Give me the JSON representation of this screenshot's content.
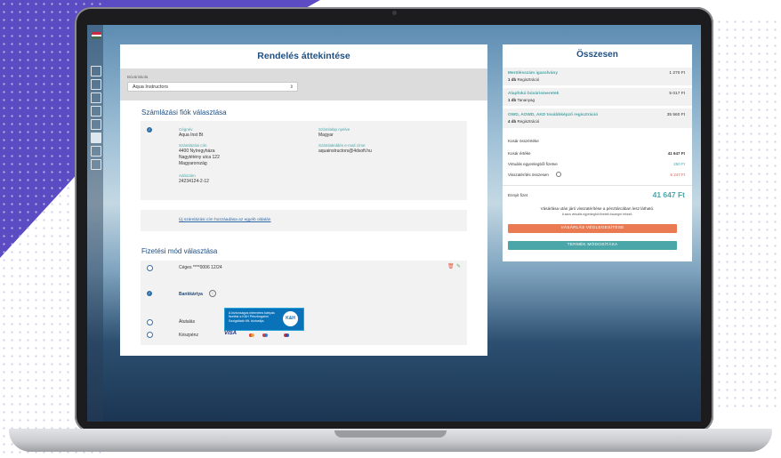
{
  "app": {
    "flag_colors": [
      "#cd2a3e",
      "#ffffff",
      "#436f4d"
    ]
  },
  "order": {
    "title": "Rendelés áttekintése",
    "diving_center_label": "Búváriskola",
    "diving_center_value": "Aqua Instructors",
    "billing_section_title": "Számlázási fiók választása",
    "billing": {
      "company_label": "Cégnév",
      "company_value": "Aqua Inst Bt",
      "language_label": "Számlalap nyelve",
      "language_value": "Magyar",
      "address_label": "Számlázási cím",
      "address_lines": [
        "4400 Nyíregyháza",
        "Nagytétény utca 122",
        "Magyarország"
      ],
      "email_label": "Számlaküldés e-mail címe",
      "email_value": "aquainstructors@4dsoft.hu",
      "tax_label": "Adószám",
      "tax_value": "24234124-2-12"
    },
    "add_billing_link": "Új számlázási cím hozzáadása az egyéb oldalán",
    "payment_section_title": "Fizetési mód választása",
    "payment": {
      "card_saved": "Céges ****0006 12/24",
      "bank_card": "Bankkártya",
      "bank_info": "A biztonságos internetes kártyás fizetést a K&H Pénzforgalmi Szolgáltató Kft. biztosítja.",
      "bank_logo": "K&H",
      "visa": "VISA",
      "transfer": "Átutalás",
      "cash": "Készpénz"
    }
  },
  "summary": {
    "title": "Összesen",
    "items": [
      {
        "name": "Merülésszám igazolvány",
        "qty": "1 db",
        "unit": "Regisztráció",
        "price": "1 270 Ft"
      },
      {
        "name": "Alapfokú búvárismeretek",
        "qty": "1 db",
        "unit": "Tananyag",
        "price": "5 017 Ft"
      },
      {
        "name": "OWD, AOWD, AKD továbbképző regisztráció",
        "qty": "4 db",
        "unit": "Regisztráció",
        "price": "35 560 Ft"
      }
    ],
    "cart_value_title": "Kosár összértéke",
    "cart_value_label": "Kosár értéke",
    "cart_value": "41 647 Ft",
    "virtual_label": "Virtuális egyenlegből fizetve",
    "virtual_value": "250 Ft",
    "refund_label": "Visszatérítés összesen",
    "refund_value": "6 247 Ft",
    "pay_label": "Ennyit fizet",
    "pay_value": "41 647 Ft",
    "note": "Vásárlása után járó visszatérítése a pénztárcában lesz látható.",
    "note_small": "A saos virtuális egyenlegből fizetett összegre érkező.",
    "finalize_button": "VÁSÁRLÁS VÉGLEGESÍTÉSE",
    "modify_button": "TERMÉK MÓDOSÍTÁSA",
    "colors": {
      "teal": "#4aa6a8",
      "orange": "#e97a52",
      "refund_red": "#e35a4a"
    }
  }
}
